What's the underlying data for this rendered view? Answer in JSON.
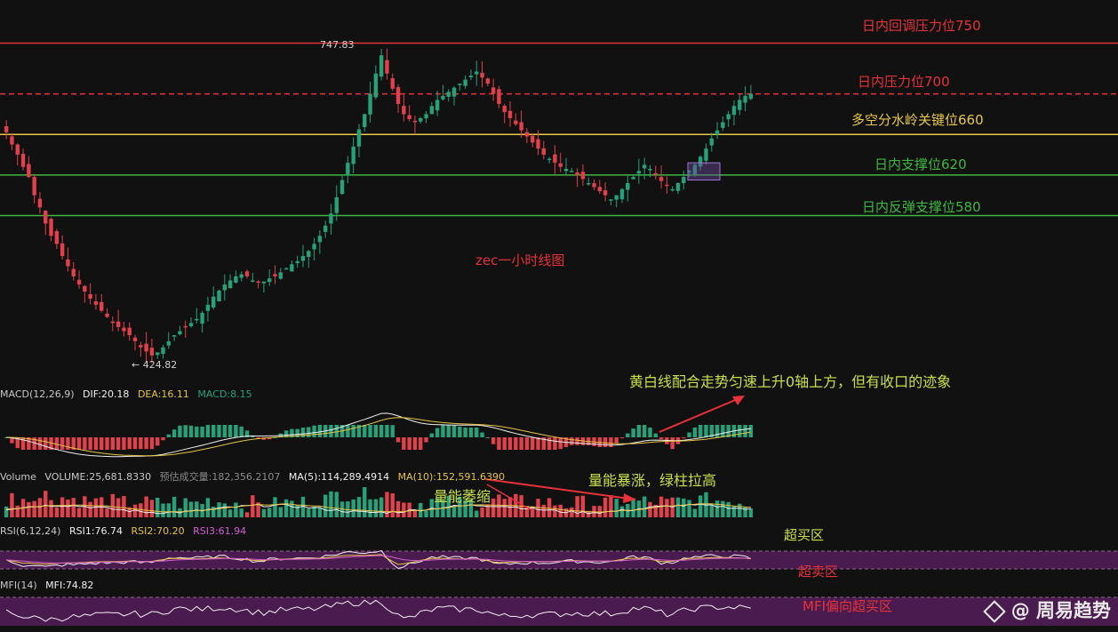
{
  "chart_data": {
    "type": "candlestick",
    "title": "zec一小时线图",
    "price_high_label": "747.83",
    "price_low_label": "424.82",
    "price_range": [
      420,
      775
    ],
    "levels": [
      {
        "value": 750,
        "label": "日内回调压力位750",
        "color": "#e8323a",
        "style": "solid"
      },
      {
        "value": 700,
        "label": "日内压力位700",
        "color": "#e8323a",
        "style": "dashed"
      },
      {
        "value": 660,
        "label": "多空分水岭关键位660",
        "color": "#e8c84a",
        "style": "solid"
      },
      {
        "value": 620,
        "label": "日内支撑位620",
        "color": "#3fb83f",
        "style": "solid"
      },
      {
        "value": 580,
        "label": "日内反弹支撑位580",
        "color": "#3fb83f",
        "style": "solid"
      }
    ],
    "close_series": [
      662,
      650,
      640,
      628,
      618,
      600,
      588,
      572,
      560,
      552,
      540,
      530,
      520,
      512,
      505,
      498,
      492,
      486,
      480,
      474,
      470,
      466,
      462,
      456,
      450,
      446,
      442,
      445,
      450,
      456,
      462,
      466,
      470,
      474,
      478,
      484,
      492,
      500,
      506,
      512,
      516,
      520,
      522,
      520,
      516,
      514,
      515,
      518,
      520,
      524,
      528,
      532,
      535,
      540,
      545,
      552,
      560,
      570,
      582,
      598,
      615,
      632,
      648,
      665,
      680,
      700,
      720,
      738,
      720,
      705,
      690,
      680,
      675,
      672,
      676,
      680,
      688,
      694,
      698,
      702,
      706,
      710,
      714,
      718,
      722,
      716,
      710,
      700,
      690,
      682,
      676,
      670,
      664,
      658,
      652,
      646,
      640,
      636,
      632,
      628,
      626,
      624,
      620,
      616,
      612,
      608,
      604,
      600,
      596,
      600,
      606,
      612,
      618,
      624,
      630,
      626,
      620,
      614,
      610,
      606,
      612,
      618,
      624,
      630,
      638,
      646,
      656,
      664,
      672,
      680,
      688,
      694,
      698,
      700
    ],
    "macd": {
      "label": "MACD(12,26,9)",
      "dif_label": "DIF:20.18",
      "dea_label": "DEA:16.11",
      "macd_label": "MACD:8.15",
      "annotation": "黄白线配合走势匀速上升0轴上方，但有收口的迹象"
    },
    "volume": {
      "label": "Volume",
      "volume_label": "VOLUME:25,681.8330",
      "forecast_label": "预估成交量:182,356.2107",
      "ma5_label": "MA(5):114,289.4914",
      "ma10_label": "MA(10):152,591.6390",
      "annotation_shrink": "量能萎缩",
      "annotation_surge": "量能暴涨，绿柱拉高"
    },
    "rsi": {
      "label": "RSI(6,12,24)",
      "rsi1_label": "RSI1:76.74",
      "rsi2_label": "RSI2:70.20",
      "rsi3_label": "RSI3:61.94",
      "overbought_label": "超买区",
      "oversold_label": "超卖区"
    },
    "mfi": {
      "label": "MFI(14)",
      "mfi_label": "MFI:74.82",
      "annotation": "MFI偏向超买区"
    },
    "watermark": "@ 周易趋势",
    "colors": {
      "up": "#26a17a",
      "down": "#e0414a",
      "dif": "#f0f0f0",
      "dea": "#e6c544",
      "zone": "#4a1b4e"
    }
  }
}
